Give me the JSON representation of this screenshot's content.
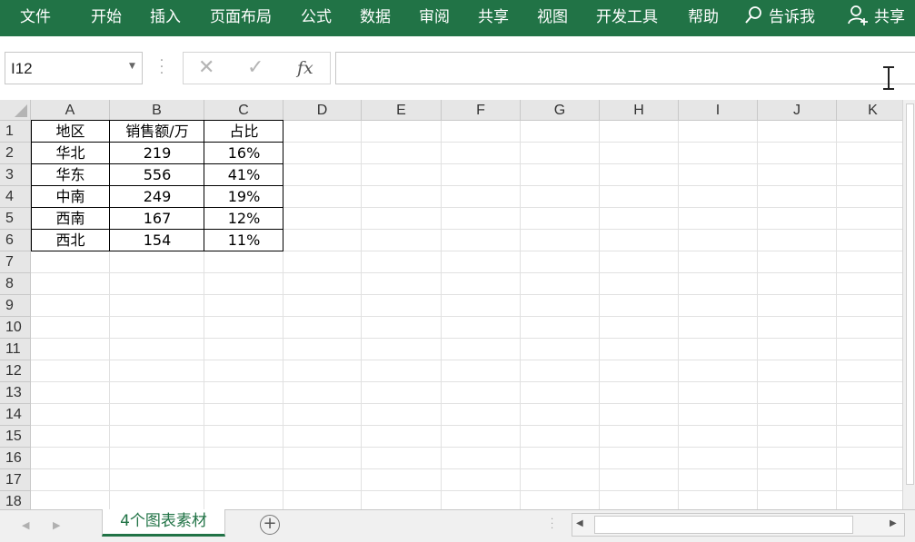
{
  "ribbon": {
    "menu": [
      "文件",
      "开始",
      "插入",
      "页面布局",
      "公式",
      "数据",
      "审阅",
      "共享",
      "视图",
      "开发工具",
      "帮助"
    ],
    "tell_me": "告诉我",
    "share": "共享",
    "accent_color": "#217346"
  },
  "formula_bar": {
    "name_box": "I12",
    "fx": "fx",
    "formula": ""
  },
  "grid": {
    "columns": [
      "A",
      "B",
      "C",
      "D",
      "E",
      "F",
      "G",
      "H",
      "I",
      "J",
      "K"
    ],
    "rows": [
      "1",
      "2",
      "3",
      "4",
      "5",
      "6",
      "7",
      "8",
      "9",
      "10",
      "11",
      "12",
      "13",
      "14",
      "15",
      "16",
      "17",
      "18"
    ],
    "table": [
      [
        "地区",
        "销售额/万",
        "占比"
      ],
      [
        "华北",
        "219",
        "16%"
      ],
      [
        "华东",
        "556",
        "41%"
      ],
      [
        "中南",
        "249",
        "19%"
      ],
      [
        "西南",
        "167",
        "12%"
      ],
      [
        "西北",
        "154",
        "11%"
      ]
    ]
  },
  "sheet_tabs": {
    "active": "4个图表素材"
  }
}
